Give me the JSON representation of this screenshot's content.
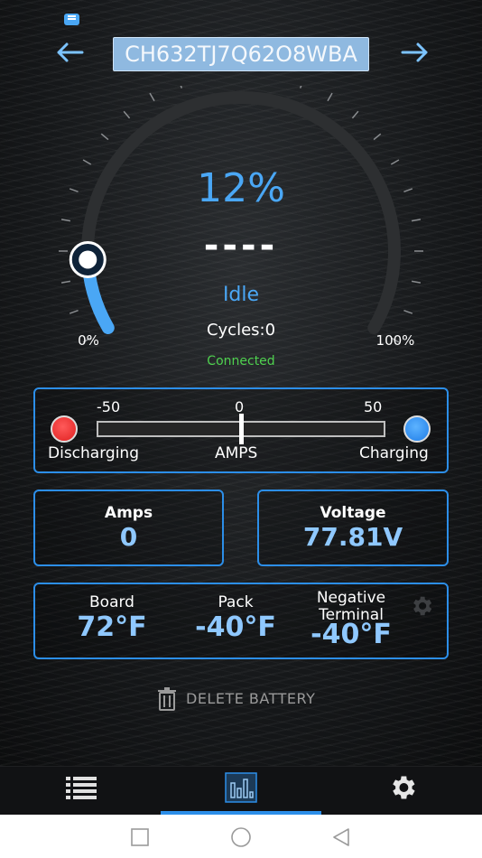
{
  "header": {
    "serial_value": "CH632TJ7Q62O8WBA",
    "prev_icon": "arrow-left-icon",
    "next_icon": "arrow-right-icon",
    "chat_icon": "chat-bubble-icon"
  },
  "gauge": {
    "percent_text": "12%",
    "charge_fraction": 0.12,
    "power_text": "----",
    "status": "Idle",
    "cycles": "Cycles:0",
    "connection": "Connected",
    "min_label": "0%",
    "max_label": "100%",
    "accent_color": "#4aa7f5"
  },
  "amps_meter": {
    "min_tick": "-50",
    "mid_tick": "0",
    "max_tick": "50",
    "current_amps": 0,
    "left_label": "Discharging",
    "center_label": "AMPS",
    "right_label": "Charging",
    "discharge_color": "#e02020",
    "charge_color": "#1f7de8"
  },
  "readouts": {
    "amps_title": "Amps",
    "amps_value": "0",
    "voltage_title": "Voltage",
    "voltage_value": "77.81V"
  },
  "temperatures": {
    "board_label": "Board",
    "board_value": "72°F",
    "pack_label": "Pack",
    "pack_value": "-40°F",
    "negative_label_line1": "Negative",
    "negative_label_line2": "Terminal",
    "negative_value": "-40°F",
    "settings_icon": "gear-icon"
  },
  "actions": {
    "delete_label": "DELETE BATTERY",
    "delete_icon": "trash-icon"
  },
  "tabs": [
    {
      "icon": "list-icon",
      "active": false
    },
    {
      "icon": "bar-chart-icon",
      "active": true
    },
    {
      "icon": "gear-icon",
      "active": false
    }
  ],
  "system_nav": {
    "recents_icon": "square-icon",
    "home_icon": "circle-icon",
    "back_icon": "triangle-back-icon"
  }
}
